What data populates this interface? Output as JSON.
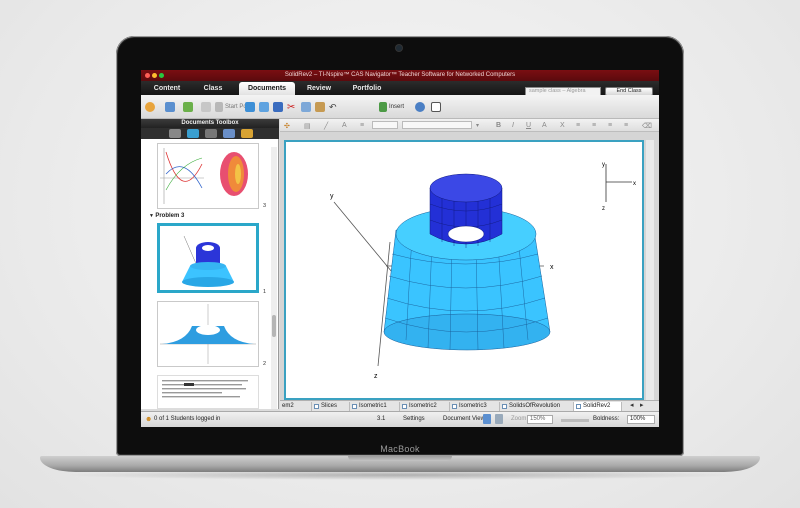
{
  "device": {
    "brand": "MacBook"
  },
  "window": {
    "title": "SolidRev2 – TI-Nspire™ CAS Navigator™ Teacher Software for Networked Computers"
  },
  "main_tabs": [
    {
      "label": "Content"
    },
    {
      "label": "Class"
    },
    {
      "label": "Documents"
    },
    {
      "label": "Review"
    },
    {
      "label": "Portfolio"
    }
  ],
  "class_selector": {
    "value": "sample class – Algebra"
  },
  "end_class": {
    "label": "End Class"
  },
  "toolbar": {
    "start_poll": "Start Poll",
    "insert": "Insert"
  },
  "toolbox": {
    "title": "Documents Toolbox"
  },
  "pages": {
    "problem3": "Problem 3",
    "num_a": "3",
    "num_b": "1",
    "num_c": "2"
  },
  "graph": {
    "axes": {
      "x": "x",
      "y": "y",
      "z": "z"
    }
  },
  "doc_tabs": [
    {
      "label": "em2"
    },
    {
      "label": "Slices"
    },
    {
      "label": "Isometric1"
    },
    {
      "label": "Isometric2"
    },
    {
      "label": "Isometric3"
    },
    {
      "label": "SolidsOfRevolution"
    },
    {
      "label": "SolidRev2"
    }
  ],
  "status": {
    "students": "0 of 1 Students logged in",
    "page": "3.1",
    "settings": "Settings",
    "doc_view": "Document View:",
    "zoom_label": "Zoom",
    "zoom_value": "150%",
    "boldness_label": "Boldness:",
    "boldness_value": "100%"
  },
  "colors": {
    "accent": "#2aa7c9",
    "titlebar": "#6e0c10",
    "solid_outer": "#39c6ff",
    "solid_inner": "#2233d6"
  }
}
